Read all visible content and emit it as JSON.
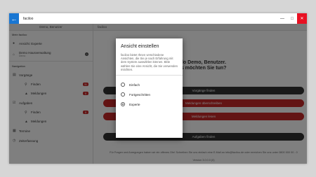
{
  "window": {
    "title": "faciloo",
    "back_icon": "arrow-left-icon",
    "minimize": "—",
    "maximize": "□",
    "close": "✕"
  },
  "sidebar": {
    "header": "Demo, Benutzer",
    "section_mein": "Mein faciloo",
    "items": [
      {
        "label": "Ansicht: Experte",
        "icon": "person-icon"
      },
      {
        "label": "Demo Hausverwaltung",
        "sublabel": "Demo",
        "icon": "home-icon",
        "badge": "0"
      }
    ],
    "section_nav": "Navigation",
    "nav": [
      {
        "label": "Vorgänge",
        "icon": "clipboard-icon"
      },
      {
        "label": "Finden",
        "icon": "search-icon",
        "badge": "31",
        "sub": true
      },
      {
        "label": "Meldungen",
        "icon": "bell-icon",
        "badge": "8",
        "sub": true
      },
      {
        "label": "Aufgaben",
        "icon": "checklist-icon"
      },
      {
        "label": "Finden",
        "icon": "search-icon",
        "badge": "8",
        "sub": true
      },
      {
        "label": "Meldungen",
        "icon": "bell-icon",
        "sub": true
      },
      {
        "label": "Termine",
        "icon": "calendar-icon"
      },
      {
        "label": "Zeiterfassung",
        "icon": "clock-icon"
      }
    ]
  },
  "main": {
    "header": "faciloo",
    "greeting_line1": "Hallo Demo, Benutzer.",
    "greeting_line2": "Was möchten Sie tun?",
    "buttons": [
      {
        "label": "Vorgänge finden",
        "style": "dark"
      },
      {
        "label": "Meldungen überschreiben",
        "style": "red"
      },
      {
        "label": "Meldungen lesen",
        "style": "red"
      },
      {
        "label": "Aufgaben finden",
        "style": "dark"
      }
    ],
    "info_text": "Für Fragen und Anregungen haben wir ein offenes Ohr! Schreiben Sie uns einfach eine E-Mail an info@faciloo.de oder erreichen Sie uns unter 0800 000 00 - 0",
    "version": "Version 3.0.0.0 (0)"
  },
  "dialog": {
    "title": "Ansicht einstellen",
    "text": "faciloo bietet Ihnen verschiedene Ansichten, die Sie je nach Erfahrung mit dem System auswählen können. Bitte wählen Sie eine Ansicht, die Sie verwenden möchten.",
    "options": [
      {
        "label": "Einfach",
        "checked": false
      },
      {
        "label": "Fortgeschritten",
        "checked": false
      },
      {
        "label": "Experte",
        "checked": true
      }
    ]
  }
}
